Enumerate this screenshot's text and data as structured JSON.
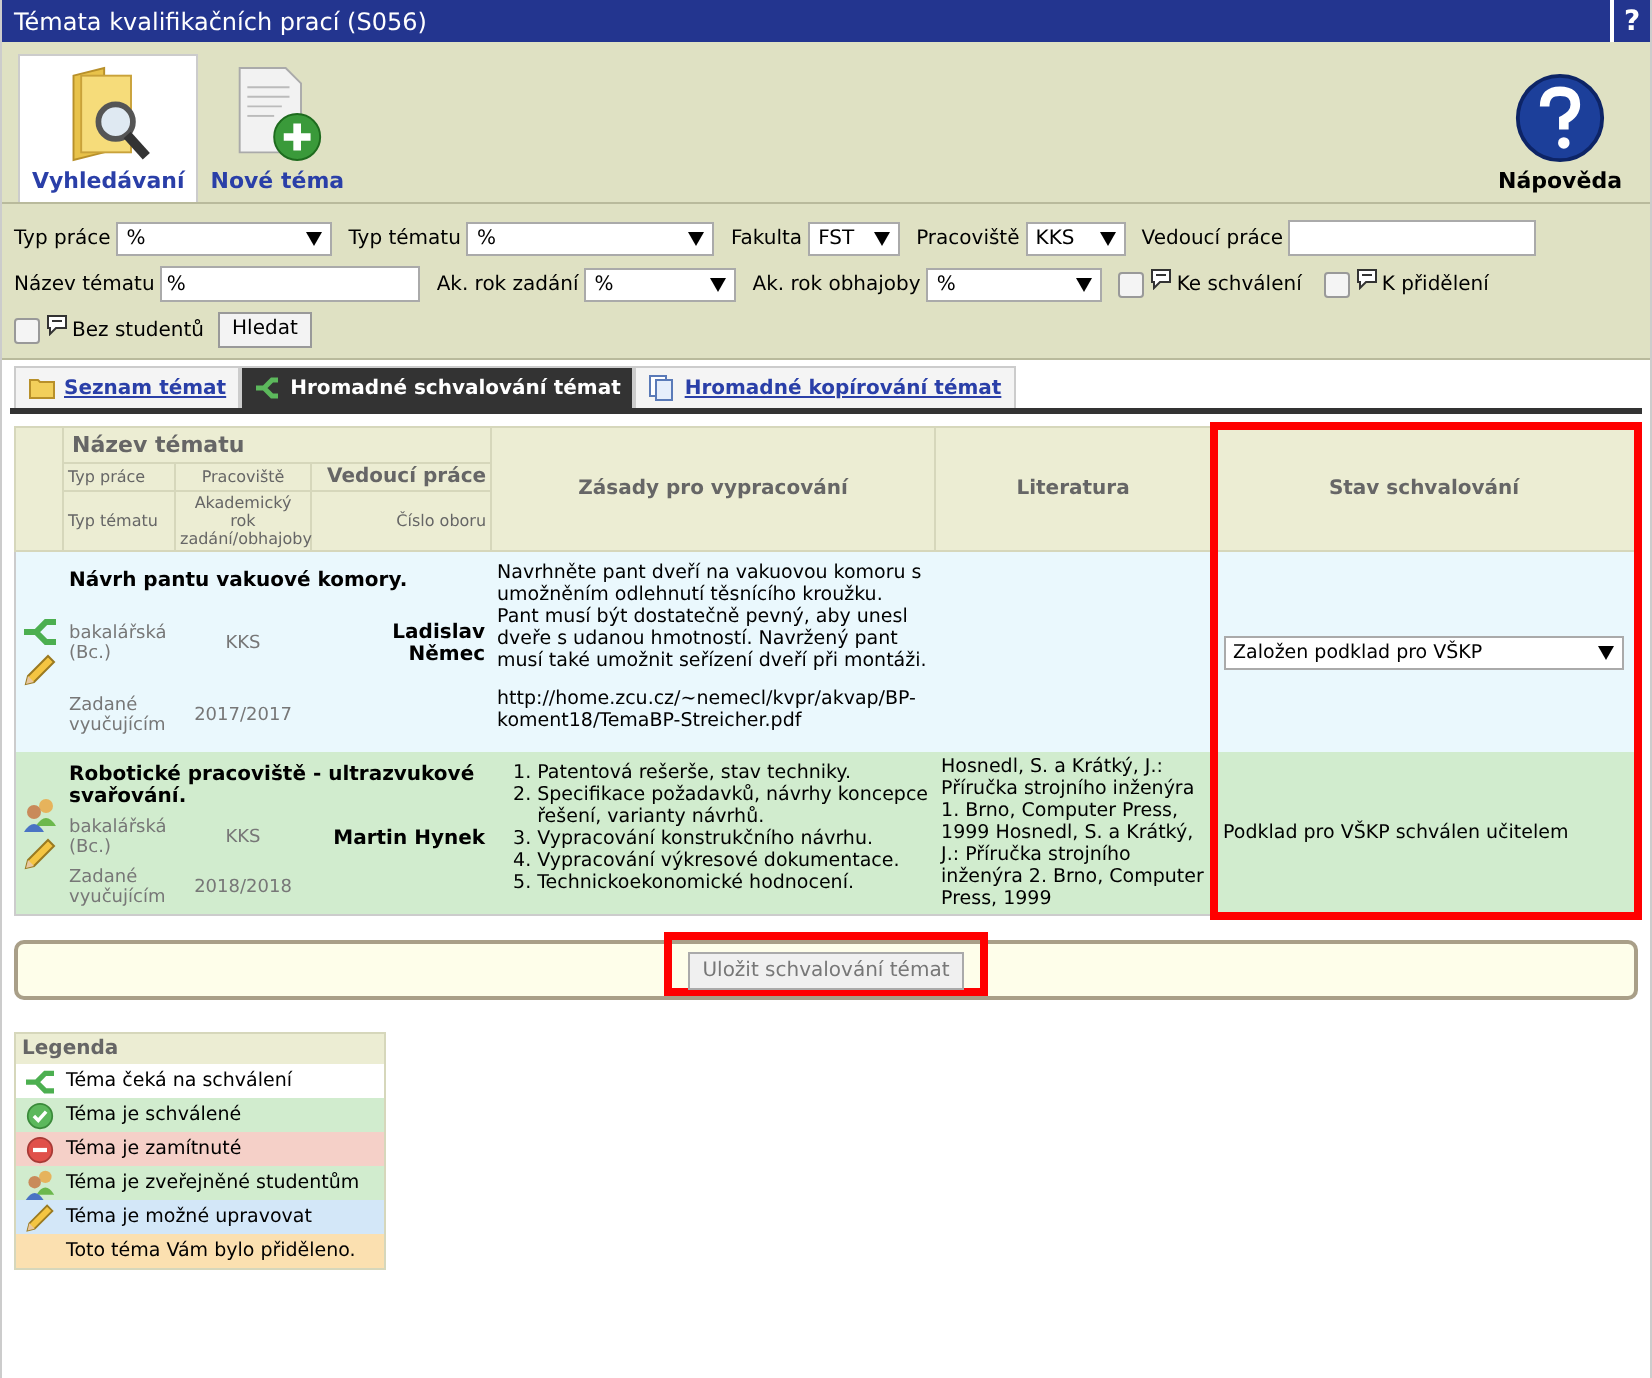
{
  "window": {
    "title": "Témata kvalifikačních prací (S056)",
    "help_glyph": "?"
  },
  "toolbar": [
    {
      "label": "Vyhledávaní",
      "kind": "search",
      "selected": true
    },
    {
      "label": "Nové téma",
      "kind": "new",
      "selected": false
    },
    {
      "label": "Nápověda",
      "kind": "help",
      "selected": false
    }
  ],
  "filters": [
    {
      "label": "Typ práce",
      "kind": "select",
      "value": "%"
    },
    {
      "label": "Typ tématu",
      "kind": "select",
      "value": "%"
    },
    {
      "label": "Fakulta",
      "kind": "select",
      "value": "FST"
    },
    {
      "label": "Pracoviště",
      "kind": "select",
      "value": "KKS"
    },
    {
      "label": "Vedoucí práce",
      "kind": "input"
    },
    {
      "label": "Název tématu",
      "kind": "input",
      "value": "%"
    },
    {
      "label": "Ak. rok zadání",
      "kind": "select",
      "value": "%"
    },
    {
      "label": "Ak. rok obhajoby",
      "kind": "select",
      "value": "%"
    },
    {
      "label": "Ke schválení",
      "kind": "check",
      "checked": false
    },
    {
      "label": "K přidělení",
      "kind": "check",
      "checked": false
    },
    {
      "label": "Bez studentů",
      "kind": "check",
      "checked": false
    },
    {
      "label": "Hledat",
      "kind": "button"
    }
  ],
  "tabs": [
    {
      "label": "Seznam témat",
      "kind": "folder",
      "selected": false
    },
    {
      "label": "Hromadné schvalování témat",
      "kind": "approve",
      "selected": true
    },
    {
      "label": "Hromadné kopírování témat",
      "kind": "copy",
      "selected": false
    }
  ],
  "table": {
    "header": {
      "name": "Název tématu",
      "type": "Typ práce",
      "dept": "Pracoviště",
      "supervisor": "Vedoucí práce",
      "topic_type": "Typ tématu",
      "year": "Akademický rok zadání/obhajoby",
      "field": "Číslo oboru",
      "principles": "Zásady pro vypracování",
      "literature": "Literatura",
      "status": "Stav schvalování",
      "status_highlighted": true
    },
    "rows": [
      {
        "color": "#eaf8fd",
        "icons": [
          {
            "kind": "waiting"
          },
          {
            "kind": "editable"
          }
        ],
        "name": "Návrh pantu vakuové komory.",
        "type": "bakalářská (Bc.)",
        "dept": "KKS",
        "supervisor": "Ladislav Němec",
        "topic_type": "Zadané vyučujícím",
        "year": "2017/2017",
        "principles": {
          "kind": "paragraphs",
          "items": [
            {
              "text": "Navrhněte pant dveří na vakuovou komoru s umožněním odlehnutí těsnícího kroužku. Pant musí být dostatečně pevný, aby unesl dveře s udanou hmotností. Navržený pant musí také umožnit seřízení dveří při montáži."
            },
            {
              "text": "http://home.zcu.cz/~nemecl/kvpr/akvap/BP-koment18/TemaBP-Streicher.pdf"
            }
          ]
        },
        "status": {
          "kind": "select",
          "text": "Založen podklad pro VŠKP"
        }
      },
      {
        "color": "#d1ecce",
        "icons": [
          {
            "kind": "published"
          },
          {
            "kind": "editable"
          }
        ],
        "name": "Robotické pracoviště - ultrazvukové svařování.",
        "type": "bakalářská (Bc.)",
        "dept": "KKS",
        "supervisor": "Martin Hynek",
        "topic_type": "Zadané vyučujícím",
        "year": "2018/2018",
        "principles": {
          "kind": "list",
          "items": [
            {
              "number": "1.",
              "text": "Patentová rešerše, stav techniky."
            },
            {
              "number": "2.",
              "text": "Specifikace požadavků,  návrhy koncepce řešení, varianty návrhů."
            },
            {
              "number": "3.",
              "text": "Vypracování konstrukčního návrhu."
            },
            {
              "number": "4.",
              "text": "Vypracování  výkresové dokumentace."
            },
            {
              "number": "5.",
              "text": "Technickoekonomické hodnocení."
            }
          ]
        },
        "literature": "Hosnedl, S. a Krátký, J.: Příručka strojního inženýra 1. Brno, Computer Press, 1999 Hosnedl, S. a Krátký, J.: Příručka strojního inženýra 2. Brno, Computer Press, 1999",
        "status": {
          "kind": "text",
          "text": "Podklad pro VŠKP schválen učitelem"
        }
      }
    ]
  },
  "save_button": {
    "label": "Uložit schvalování témat",
    "highlighted": true,
    "disabled": true
  },
  "legend": {
    "title": "Legenda",
    "items": [
      {
        "kind": "waiting",
        "color": "#ffffff",
        "label": "Téma čeká na schválení"
      },
      {
        "kind": "approved",
        "color": "#d1ecce",
        "label": "Téma je schválené"
      },
      {
        "kind": "rejected",
        "color": "#f5d0c8",
        "label": "Téma je zamítnuté"
      },
      {
        "kind": "published",
        "color": "#d1ecce",
        "label": "Téma je zveřejněné studentům"
      },
      {
        "kind": "editable",
        "color": "#d3e7f8",
        "label": "Téma je možné upravovat"
      },
      {
        "kind": "none",
        "color": "#fbe0b0",
        "label": "Toto téma Vám bylo přiděleno."
      }
    ]
  }
}
